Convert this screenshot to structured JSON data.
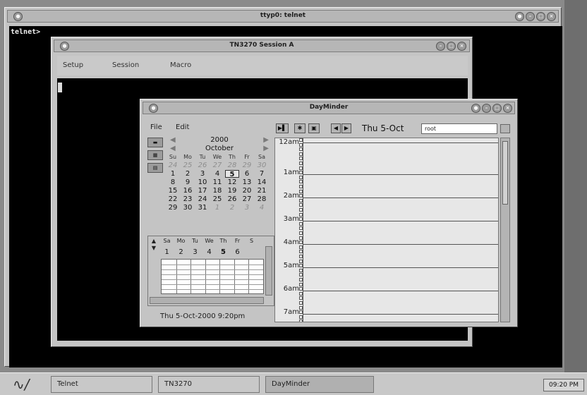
{
  "xterm": {
    "title": "ttyp0: telnet",
    "prompt": "telnet>",
    "buttons": [
      "●",
      "–",
      "□",
      "×"
    ]
  },
  "tn3270": {
    "title": "TN3270 Session A",
    "menu": [
      "Setup",
      "Session",
      "Macro"
    ],
    "buttons": [
      "–",
      "□",
      "×"
    ]
  },
  "dayminder": {
    "title": "DayMinder",
    "menu": [
      "File",
      "Edit"
    ],
    "buttons": [
      "●",
      "–",
      "□",
      "×"
    ],
    "side_icons": [
      "side-day-icon",
      "side-week-icon",
      "side-month-icon"
    ],
    "month_calendar": {
      "year": "2000",
      "month": "October",
      "weekdays": [
        "Su",
        "Mo",
        "Tu",
        "We",
        "Th",
        "Fr",
        "Sa"
      ],
      "weeks": [
        [
          "24",
          "25",
          "26",
          "27",
          "28",
          "29",
          "30"
        ],
        [
          "1",
          "2",
          "3",
          "4",
          "5",
          "6",
          "7"
        ],
        [
          "8",
          "9",
          "10",
          "11",
          "12",
          "13",
          "14"
        ],
        [
          "15",
          "16",
          "17",
          "18",
          "19",
          "20",
          "21"
        ],
        [
          "22",
          "23",
          "24",
          "25",
          "26",
          "27",
          "28"
        ],
        [
          "29",
          "30",
          "31",
          "1",
          "2",
          "3",
          "4"
        ]
      ],
      "selected": "5"
    },
    "week_view": {
      "days": [
        "Sa",
        "Mo",
        "Tu",
        "We",
        "Th",
        "Fr",
        "S"
      ],
      "numbers": [
        "1",
        "2",
        "3",
        "4",
        "5",
        "6",
        ""
      ]
    },
    "status": "Thu 5-Oct-2000 9:20pm",
    "toolbar": {
      "date": "Thu 5-Oct",
      "input_text": "root"
    },
    "hours": [
      "12am",
      "1am",
      "2am",
      "3am",
      "4am",
      "5am",
      "6am",
      "7am"
    ]
  },
  "taskbar": {
    "tasks": [
      "Telnet",
      "TN3270",
      "DayMinder"
    ],
    "active": "DayMinder",
    "clock": "09:20 PM"
  }
}
